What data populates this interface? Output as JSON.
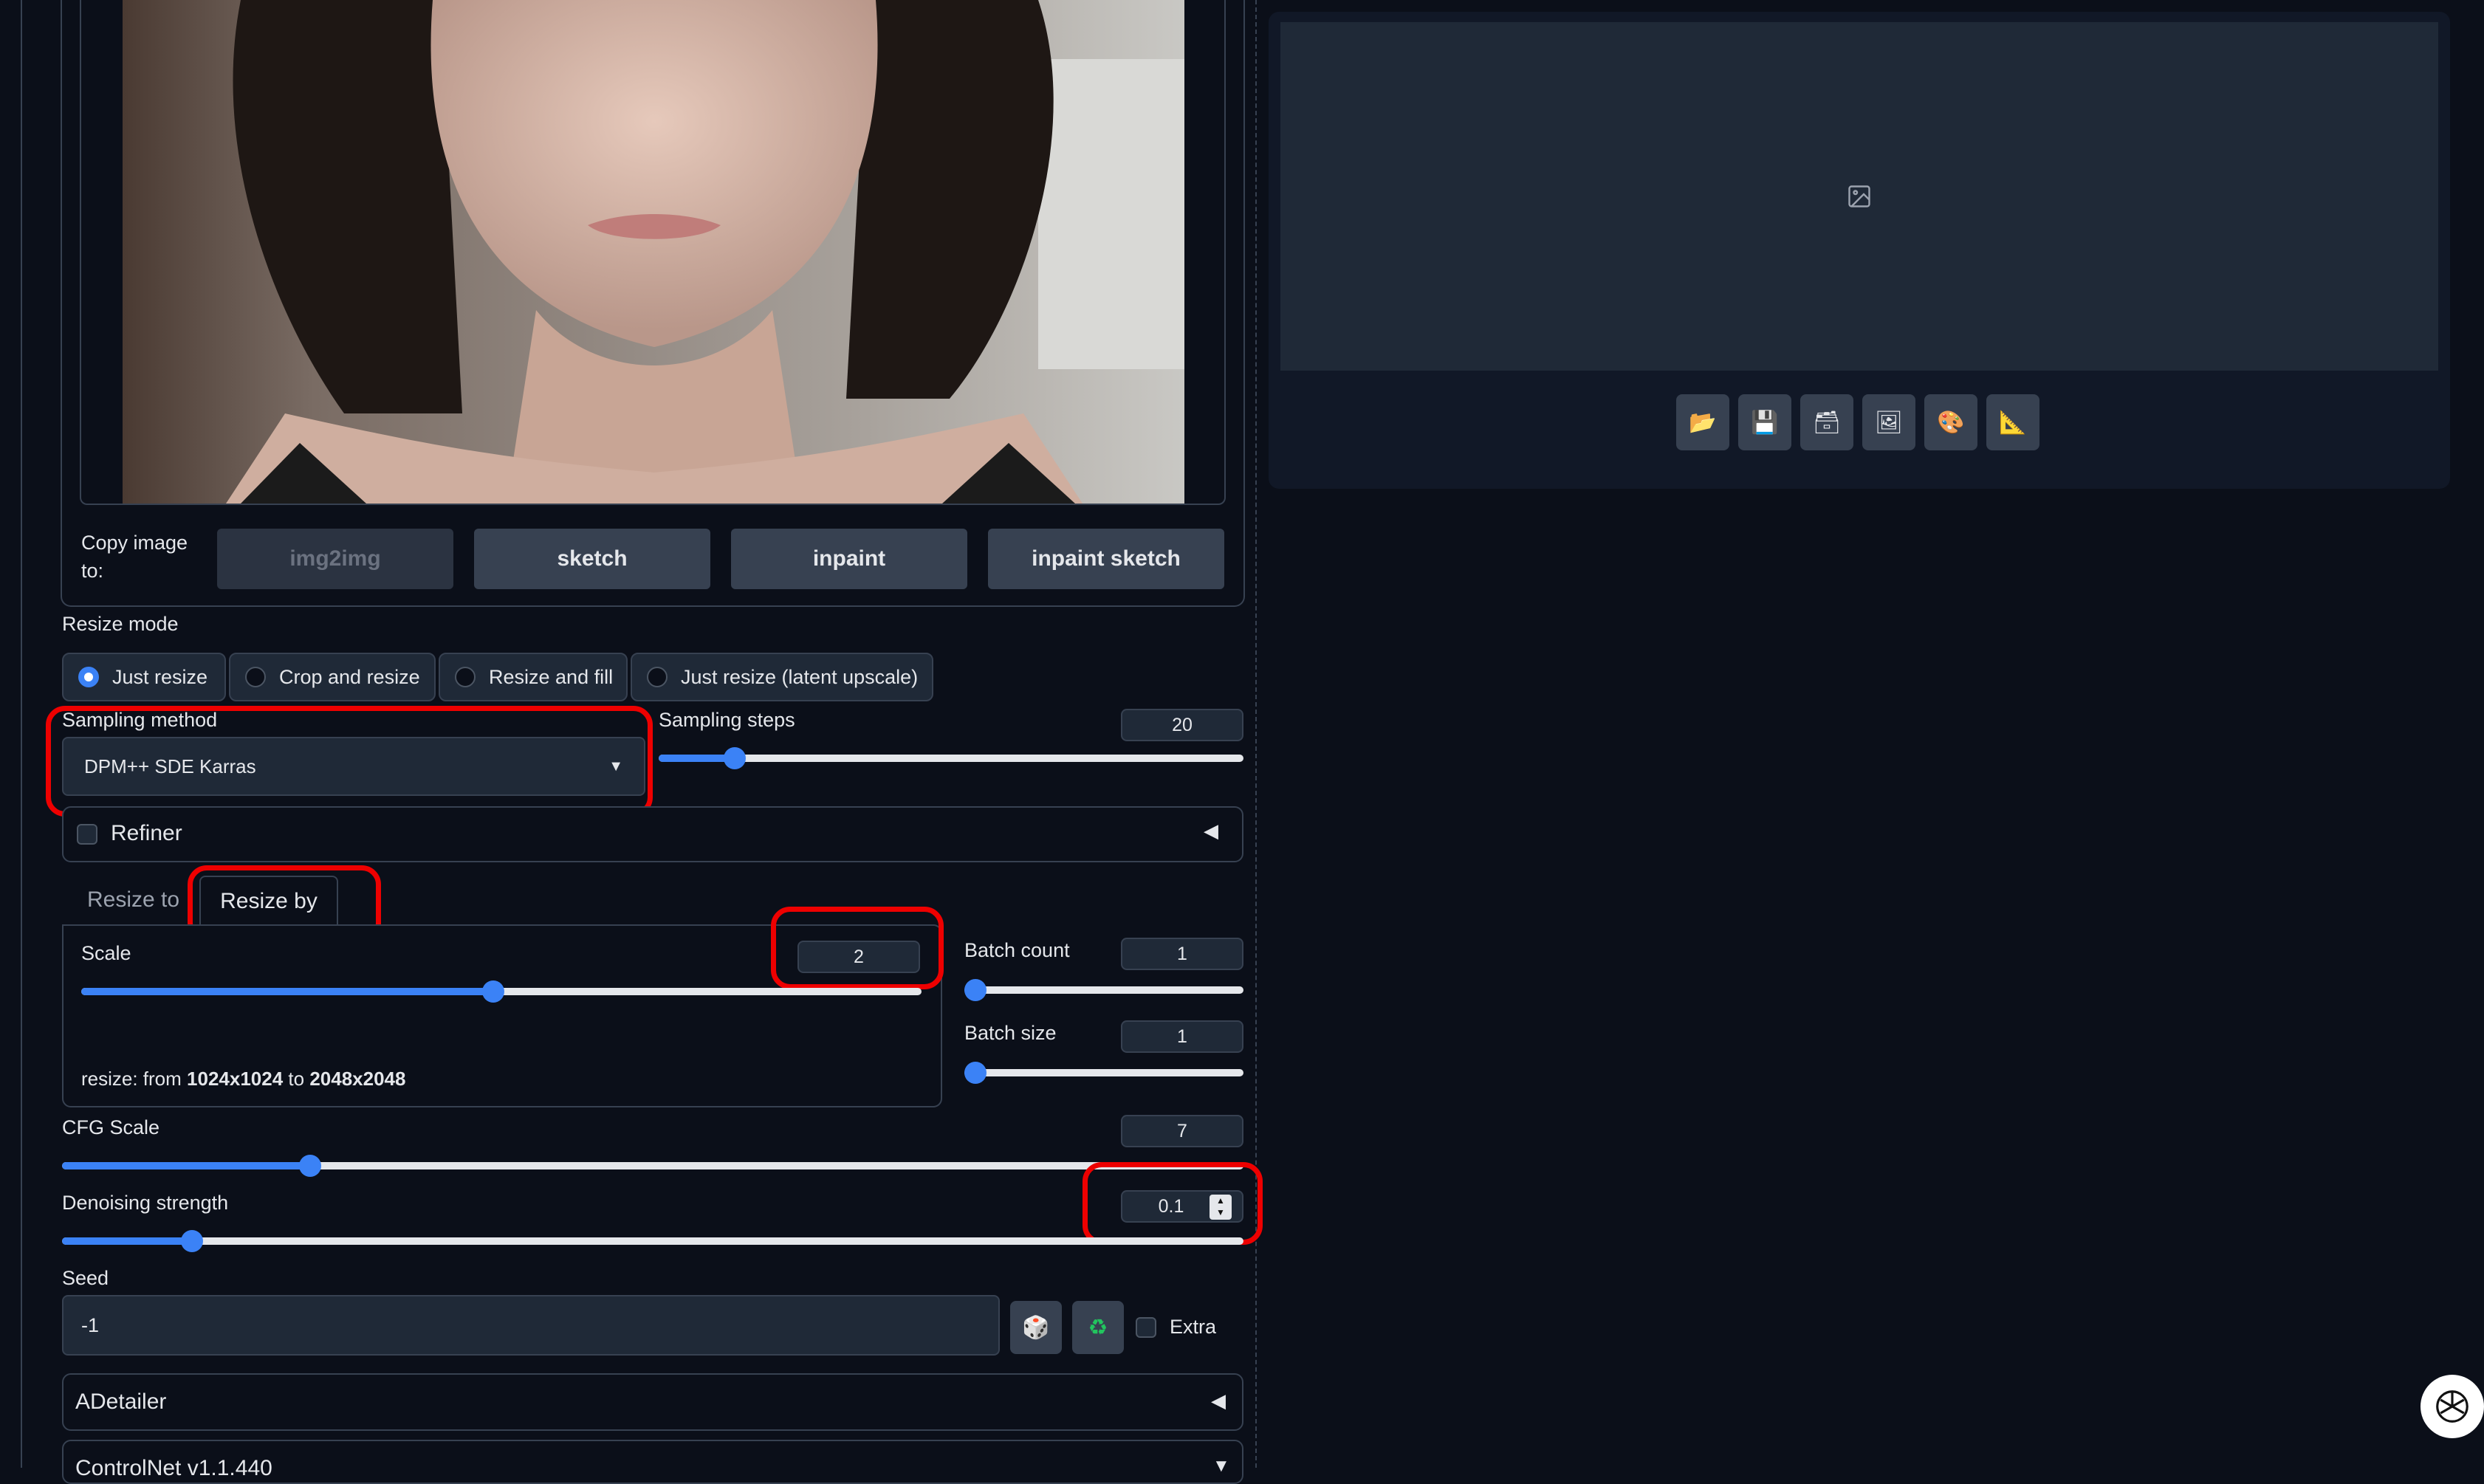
{
  "copy_image": {
    "label": "Copy image to:",
    "buttons": [
      "img2img",
      "sketch",
      "inpaint",
      "inpaint sketch"
    ]
  },
  "resize_mode": {
    "label": "Resize mode",
    "options": [
      "Just resize",
      "Crop and resize",
      "Resize and fill",
      "Just resize (latent upscale)"
    ],
    "selected": "Just resize"
  },
  "sampling_method": {
    "label": "Sampling method",
    "value": "DPM++ SDE Karras"
  },
  "sampling_steps": {
    "label": "Sampling steps",
    "value": "20",
    "fraction": 0.13
  },
  "refiner": {
    "label": "Refiner"
  },
  "resize_tabs": {
    "tabs": [
      "Resize to",
      "Resize by"
    ],
    "active": "Resize by"
  },
  "scale": {
    "label": "Scale",
    "value": "2",
    "fraction": 0.49,
    "resize_prefix": "resize: from ",
    "from": "1024x1024",
    "to_word": " to ",
    "to": "2048x2048"
  },
  "batch_count": {
    "label": "Batch count",
    "value": "1",
    "fraction": 0.0
  },
  "batch_size": {
    "label": "Batch size",
    "value": "1",
    "fraction": 0.0
  },
  "cfg_scale": {
    "label": "CFG Scale",
    "value": "7",
    "fraction": 0.21
  },
  "denoising": {
    "label": "Denoising strength",
    "value": "0.1",
    "fraction": 0.11
  },
  "seed": {
    "label": "Seed",
    "value": "-1",
    "extra_label": "Extra"
  },
  "adetailer": {
    "label": "ADetailer"
  },
  "controlnet": {
    "label": "ControlNet v1.1.440"
  },
  "colors": {
    "accent": "#3b82f6",
    "highlight": "#e00000",
    "bg": "#0b0f19"
  }
}
